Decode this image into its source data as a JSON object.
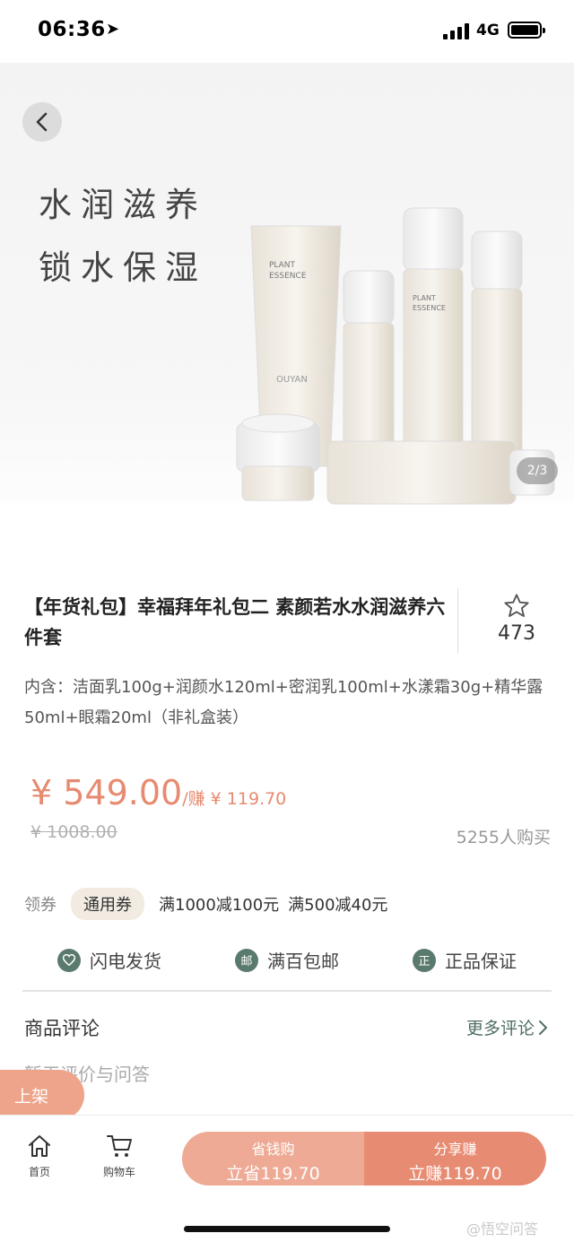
{
  "status": {
    "time": "06:36",
    "network": "4G"
  },
  "hero": {
    "slogan_line1": "水润滋养",
    "slogan_line2": "锁水保湿",
    "page_indicator": "2/3",
    "bottle_texts": {
      "line1": "PLANT",
      "line2": "ESSENCE",
      "brand": "OUYAN"
    }
  },
  "product": {
    "title": "【年货礼包】幸福拜年礼包二 素颜若水水润滋养六件套",
    "favorite_count": "473",
    "contents": "内含：洁面乳100g+润颜水120ml+密润乳100ml+水漾霜30g+精华露50ml+眼霜20ml（非礼盒装）",
    "price": "¥ 549.00",
    "earn_text": "/赚 ¥ 119.70",
    "original_price": "¥ 1008.00",
    "buyers": "5255人购买"
  },
  "coupon": {
    "label": "领券",
    "tag": "通用券",
    "offers": [
      "满1000减100元",
      "满500减40元"
    ]
  },
  "guarantees": [
    {
      "icon": "heart-icon",
      "icon_text": "",
      "label": "闪电发货"
    },
    {
      "icon": "mail-icon",
      "icon_text": "邮",
      "label": "满百包邮"
    },
    {
      "icon": "authentic-icon",
      "icon_text": "正",
      "label": "正品保证"
    }
  ],
  "reviews": {
    "title": "商品评论",
    "more": "更多评论",
    "empty": "暂无评价与问答"
  },
  "shelf_button": "上架",
  "bottom_nav": {
    "home": "首页",
    "cart": "购物车",
    "save_buy_l1": "省钱购",
    "save_buy_l2": "立省119.70",
    "share_earn_l1": "分享赚",
    "share_earn_l2": "立赚119.70"
  },
  "watermark": "@悟空问答",
  "colors": {
    "accent": "#e68a70",
    "green": "#5a7a6e",
    "button_light": "#eeaa95",
    "button_dark": "#e78c73"
  }
}
